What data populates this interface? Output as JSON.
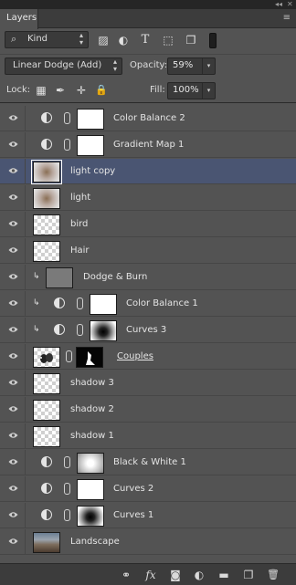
{
  "panel": {
    "title": "Layers",
    "collapse_glyph": "◂◂",
    "close_glyph": "✕",
    "menu_glyph": "≡"
  },
  "filter": {
    "kind_label": "Kind",
    "search_glyph": "⌕",
    "updown_glyph": "▴▾",
    "icons": [
      "image-filter-icon",
      "adjustment-filter-icon",
      "type-filter-icon",
      "shape-filter-icon",
      "smart-object-filter-icon"
    ],
    "type_glyph": "T",
    "shape_glyph": "⬚",
    "image_glyph": "▨",
    "adj_glyph": "◐",
    "smart_glyph": "❐"
  },
  "blend": {
    "mode": "Linear Dodge (Add)",
    "opacity_label": "Opacity:",
    "opacity_value": "59%",
    "dropdown_glyph": "▾"
  },
  "lock": {
    "label": "Lock:",
    "fill_label": "Fill:",
    "fill_value": "100%",
    "pixels_glyph": "▦",
    "brush_glyph": "✒",
    "move_glyph": "✛",
    "all_glyph": "🔒"
  },
  "layers": [
    {
      "name": "Color Balance 2",
      "kind": "adjustment",
      "clipped": false,
      "thumb": "white",
      "selected": false
    },
    {
      "name": "Gradient Map 1",
      "kind": "adjustment",
      "clipped": false,
      "thumb": "white",
      "selected": false
    },
    {
      "name": "light copy",
      "kind": "pixel",
      "clipped": false,
      "thumb": "light",
      "selected": true
    },
    {
      "name": "light",
      "kind": "pixel",
      "clipped": false,
      "thumb": "light",
      "selected": false
    },
    {
      "name": "bird",
      "kind": "pixel",
      "clipped": false,
      "thumb": "checker",
      "selected": false
    },
    {
      "name": "Hair",
      "kind": "pixel",
      "clipped": false,
      "thumb": "checker",
      "selected": false
    },
    {
      "name": "Dodge & Burn",
      "kind": "pixel",
      "clipped": true,
      "thumb": "gray",
      "selected": false
    },
    {
      "name": "Color Balance 1",
      "kind": "adjustment",
      "clipped": true,
      "thumb": "white",
      "selected": false
    },
    {
      "name": "Curves 3",
      "kind": "adjustment",
      "clipped": true,
      "thumb": "dark-spot",
      "selected": false
    },
    {
      "name": "Couples",
      "kind": "masked",
      "clipped": false,
      "thumb": "couple",
      "selected": false
    },
    {
      "name": "shadow 3",
      "kind": "pixel",
      "clipped": false,
      "thumb": "checker",
      "selected": false
    },
    {
      "name": "shadow 2",
      "kind": "pixel",
      "clipped": false,
      "thumb": "checker",
      "selected": false
    },
    {
      "name": "shadow 1",
      "kind": "pixel",
      "clipped": false,
      "thumb": "checker",
      "selected": false
    },
    {
      "name": "Black & White 1",
      "kind": "adjustment",
      "clipped": false,
      "thumb": "bw",
      "selected": false
    },
    {
      "name": "Curves 2",
      "kind": "adjustment",
      "clipped": false,
      "thumb": "white",
      "selected": false
    },
    {
      "name": "Curves 1",
      "kind": "adjustment",
      "clipped": false,
      "thumb": "dark-spot",
      "selected": false
    },
    {
      "name": "Landscape",
      "kind": "pixel",
      "clipped": false,
      "thumb": "landscape",
      "selected": false
    }
  ],
  "clip_glyph": "↳",
  "footer": {
    "link_glyph": "⚭",
    "fx_label": "fx",
    "mask_glyph": "◙",
    "adj_glyph": "◐",
    "group_glyph": "▬",
    "new_glyph": "❐",
    "trash_glyph": "🗑"
  },
  "colors": {
    "panel_bg": "#535353",
    "selected_row": "#4a5572",
    "header_bg": "#3c3c3c"
  }
}
